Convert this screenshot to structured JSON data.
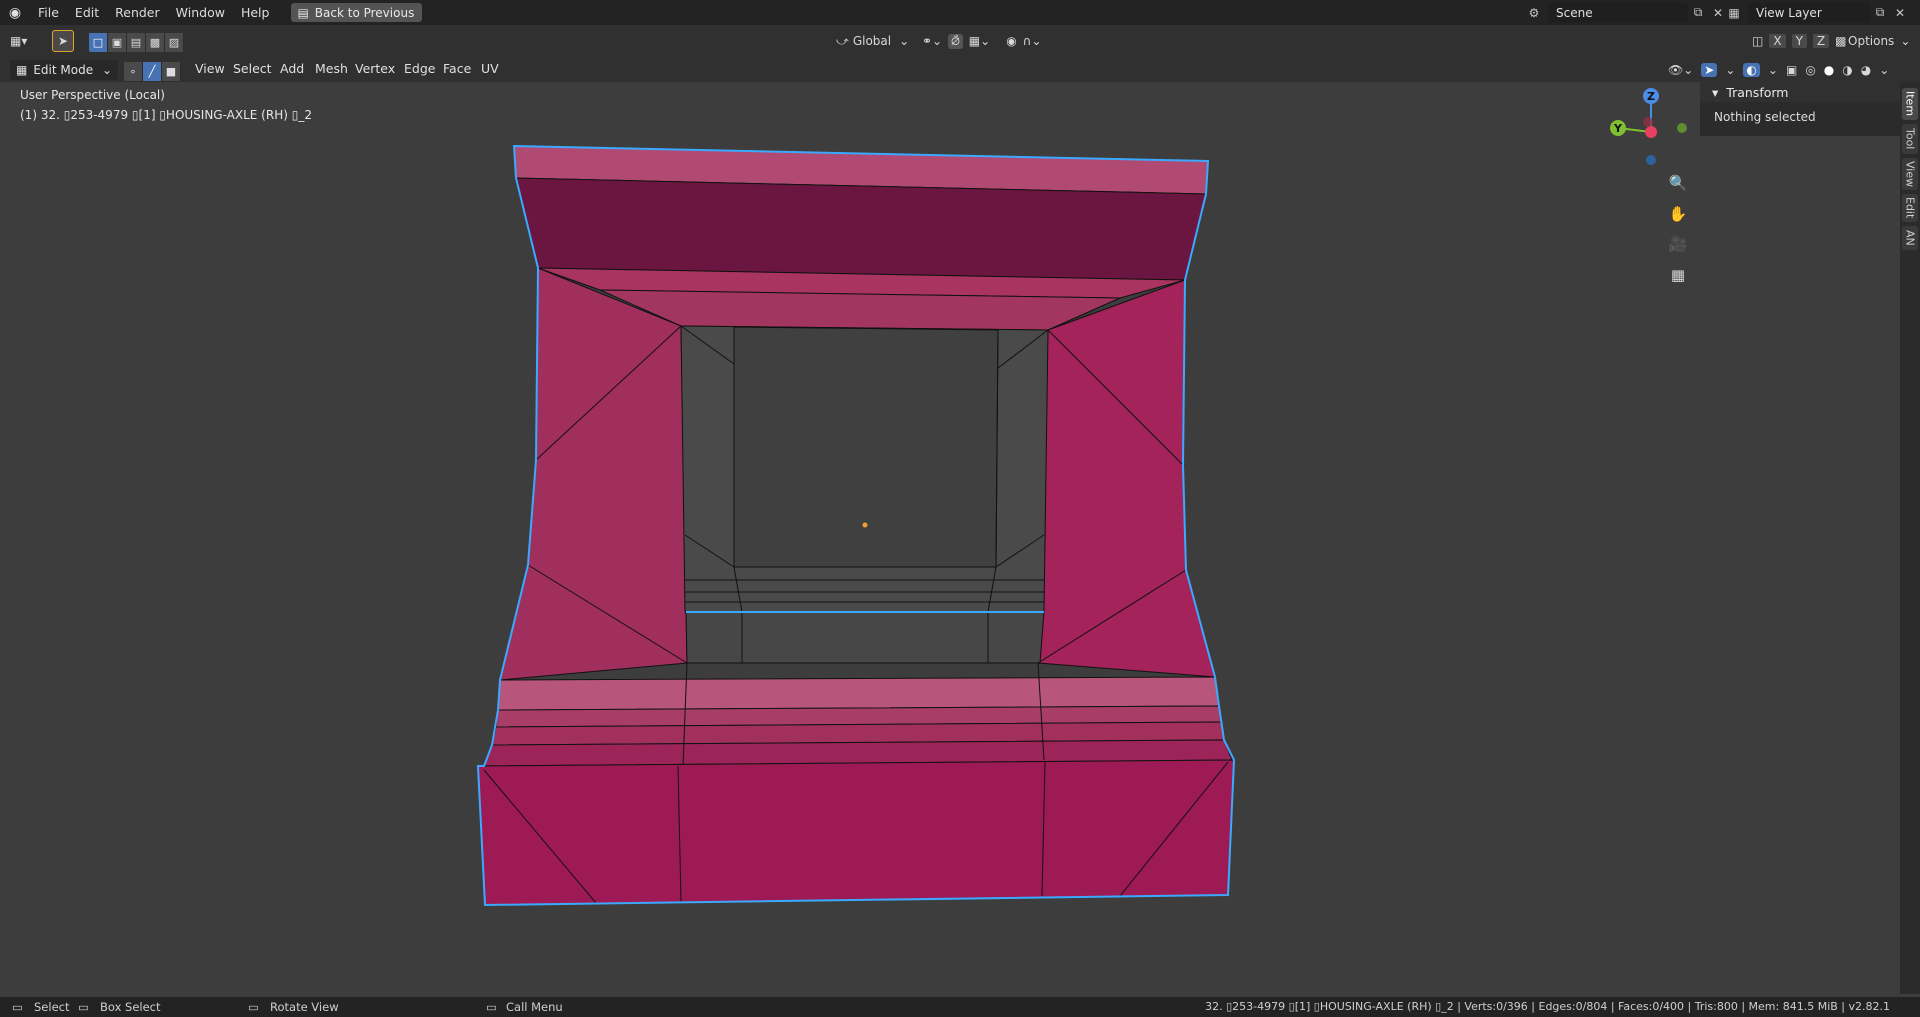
{
  "menubar": {
    "items": [
      "File",
      "Edit",
      "Render",
      "Window",
      "Help"
    ],
    "back_button": "Back to Previous",
    "scene_label": "Scene",
    "view_layer_label": "View Layer"
  },
  "header": {
    "orientation": "Global",
    "options_label": "Options",
    "mode": "Edit Mode",
    "menus": [
      "View",
      "Select",
      "Add",
      "Mesh",
      "Vertex",
      "Edge",
      "Face",
      "UV"
    ],
    "axis_toggles": [
      "X",
      "Y",
      "Z"
    ]
  },
  "viewport": {
    "perspective_label": "User Perspective (Local)",
    "object_info": "(1) 32. ▯253-4979 ▯[1] ▯HOUSING-AXLE (RH) ▯_2",
    "gizmo_axes": {
      "z": "Z",
      "y": "Y"
    },
    "colors": {
      "face_fill": "#9e1a55",
      "face_dark": "#6b1640",
      "face_light": "#b8557a",
      "inner_gray": "#4a4a4a",
      "edge_highlight": "#3aa9ff"
    }
  },
  "npanel": {
    "section_title": "Transform",
    "empty_text": "Nothing selected",
    "tabs": [
      "Item",
      "Tool",
      "View",
      "Edit",
      "AN"
    ]
  },
  "statusbar": {
    "select": "Select",
    "box_select": "Box Select",
    "rotate_view": "Rotate View",
    "call_menu": "Call Menu",
    "stats": "32. ▯253-4979 ▯[1] ▯HOUSING-AXLE (RH) ▯_2 | Verts:0/396 | Edges:0/804 | Faces:0/400 | Tris:800 | Mem: 841.5 MiB | v2.82.1"
  }
}
